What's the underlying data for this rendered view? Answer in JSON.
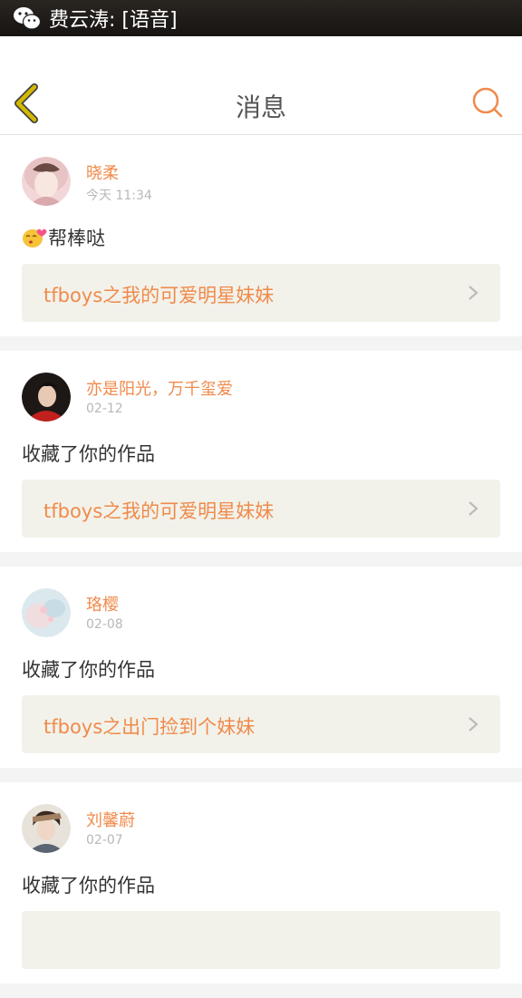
{
  "status": {
    "text": "费云涛: [语音]"
  },
  "header": {
    "title": "消息"
  },
  "messages": [
    {
      "name": "晓柔",
      "time": "今天 11:34",
      "text": "帮棒哒",
      "emoji": "kiss-emoji-icon",
      "work": "tfboys之我的可爱明星妹妹"
    },
    {
      "name": "亦是阳光，万千玺爱",
      "time": "02-12",
      "text": "收藏了你的作品",
      "work": "tfboys之我的可爱明星妹妹"
    },
    {
      "name": "珞樱",
      "time": "02-08",
      "text": "收藏了你的作品",
      "work": "tfboys之出门捡到个妹妹"
    },
    {
      "name": "刘馨蔚",
      "time": "02-07",
      "text": "收藏了你的作品",
      "work": ""
    }
  ],
  "colors": {
    "accent": "#f08a4b",
    "link_bg": "#f2f2ea",
    "back_arrow": "#d4b800"
  }
}
